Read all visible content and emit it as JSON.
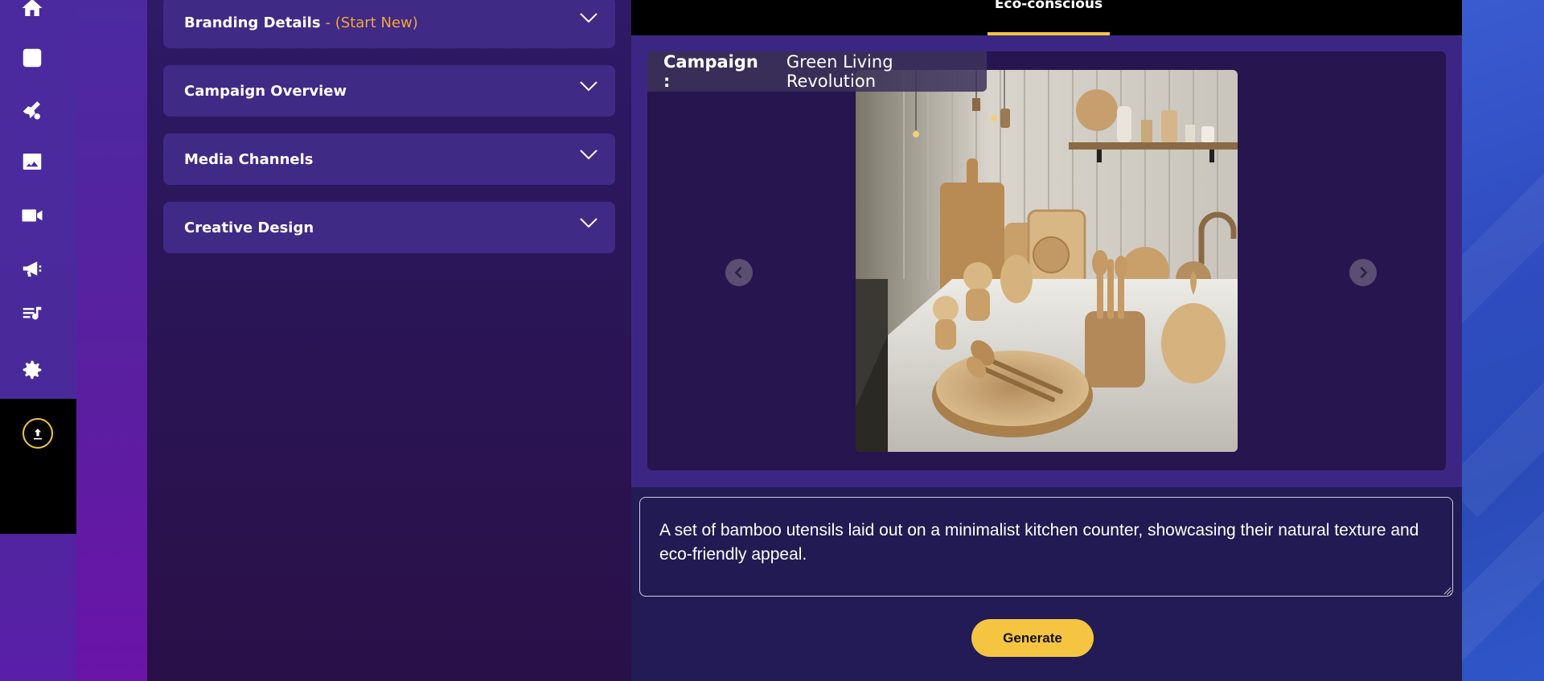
{
  "sidebar": {
    "icons": [
      "home-icon",
      "stack-icon",
      "rocket-gear-icon",
      "image-icon",
      "video-icon",
      "megaphone-icon",
      "music-note-icon",
      "settings-icon"
    ],
    "upload_icon": "upload-icon"
  },
  "accordions": [
    {
      "label": "Branding Details",
      "tag": "- (Start New)"
    },
    {
      "label": "Campaign Overview",
      "tag": ""
    },
    {
      "label": "Media Channels",
      "tag": ""
    },
    {
      "label": "Creative Design",
      "tag": ""
    }
  ],
  "tabs": {
    "active_label": "Eco-conscious"
  },
  "viewer": {
    "campaign_key": "Campaign :",
    "campaign_value": "Green Living Revolution"
  },
  "prompt": {
    "text": "A set of bamboo utensils laid out on a minimalist kitchen counter, showcasing their natural texture and eco-friendly appeal."
  },
  "generate_label": "Generate",
  "colors": {
    "accent": "#f5c542",
    "tag_orange": "#f3a638",
    "sidebar": "#4a2a9e",
    "panel": "#3f2a86",
    "main": "#231b55"
  }
}
